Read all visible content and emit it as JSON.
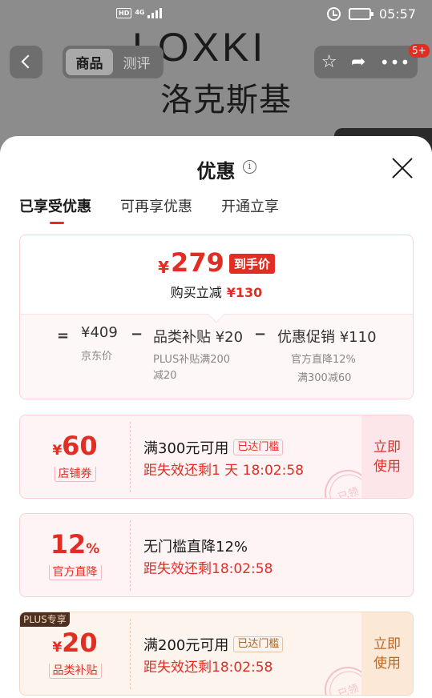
{
  "status_bar": {
    "hd": "HD",
    "network": "4G",
    "time": "05:57"
  },
  "background_page": {
    "logo_text": "LOXKI",
    "logo_cn": "洛克斯基",
    "tabs": [
      "商品",
      "测评"
    ],
    "message_badge": "5+"
  },
  "sheet": {
    "title": "优惠",
    "info_icon_glyph": "i",
    "tabs": [
      {
        "label": "已享受优惠",
        "active": true
      },
      {
        "label": "可再享优惠",
        "active": false
      },
      {
        "label": "开通立享",
        "active": false
      }
    ],
    "summary": {
      "currency": "¥",
      "final_price": "279",
      "final_price_tag": "到手价",
      "reduce_label": "购买立减",
      "reduce_amount": "¥130",
      "eq": "=",
      "minus1": "−",
      "minus2": "−",
      "base_price": "¥409",
      "base_label": "京东价",
      "subsidy": "品类补贴 ¥20",
      "subsidy_desc_1": "PLUS补贴满200",
      "subsidy_desc_2": "减20",
      "promo": "优惠促销 ¥110",
      "promo_desc_1": "官方直降12%",
      "promo_desc_2": "满300减60"
    },
    "coupons": [
      {
        "currency": "¥",
        "value": "60",
        "suffix": "",
        "tag": "店铺券",
        "title": "满300元可用",
        "reached": "已达门槛",
        "expire": "距失效还剩1 天 18:02:58",
        "action_1": "立即",
        "action_2": "使用",
        "stamp": "已领"
      },
      {
        "currency": "",
        "value": "12",
        "suffix": "%",
        "tag": "官方直降",
        "title": "无门槛直降12%",
        "expire": "距失效还剩18:02:58"
      },
      {
        "plus_badge": "PLUS专享",
        "currency": "¥",
        "value": "20",
        "suffix": "",
        "tag": "品类补贴",
        "title": "满200元可用",
        "reached": "已达门槛",
        "expire": "距失效还剩18:02:58",
        "action_1": "立即",
        "action_2": "使用",
        "stamp": "已领"
      }
    ]
  },
  "colors": {
    "accent_red": "#e02e24",
    "plus_gold": "#c4651b",
    "card_border": "#fbd2d2"
  }
}
